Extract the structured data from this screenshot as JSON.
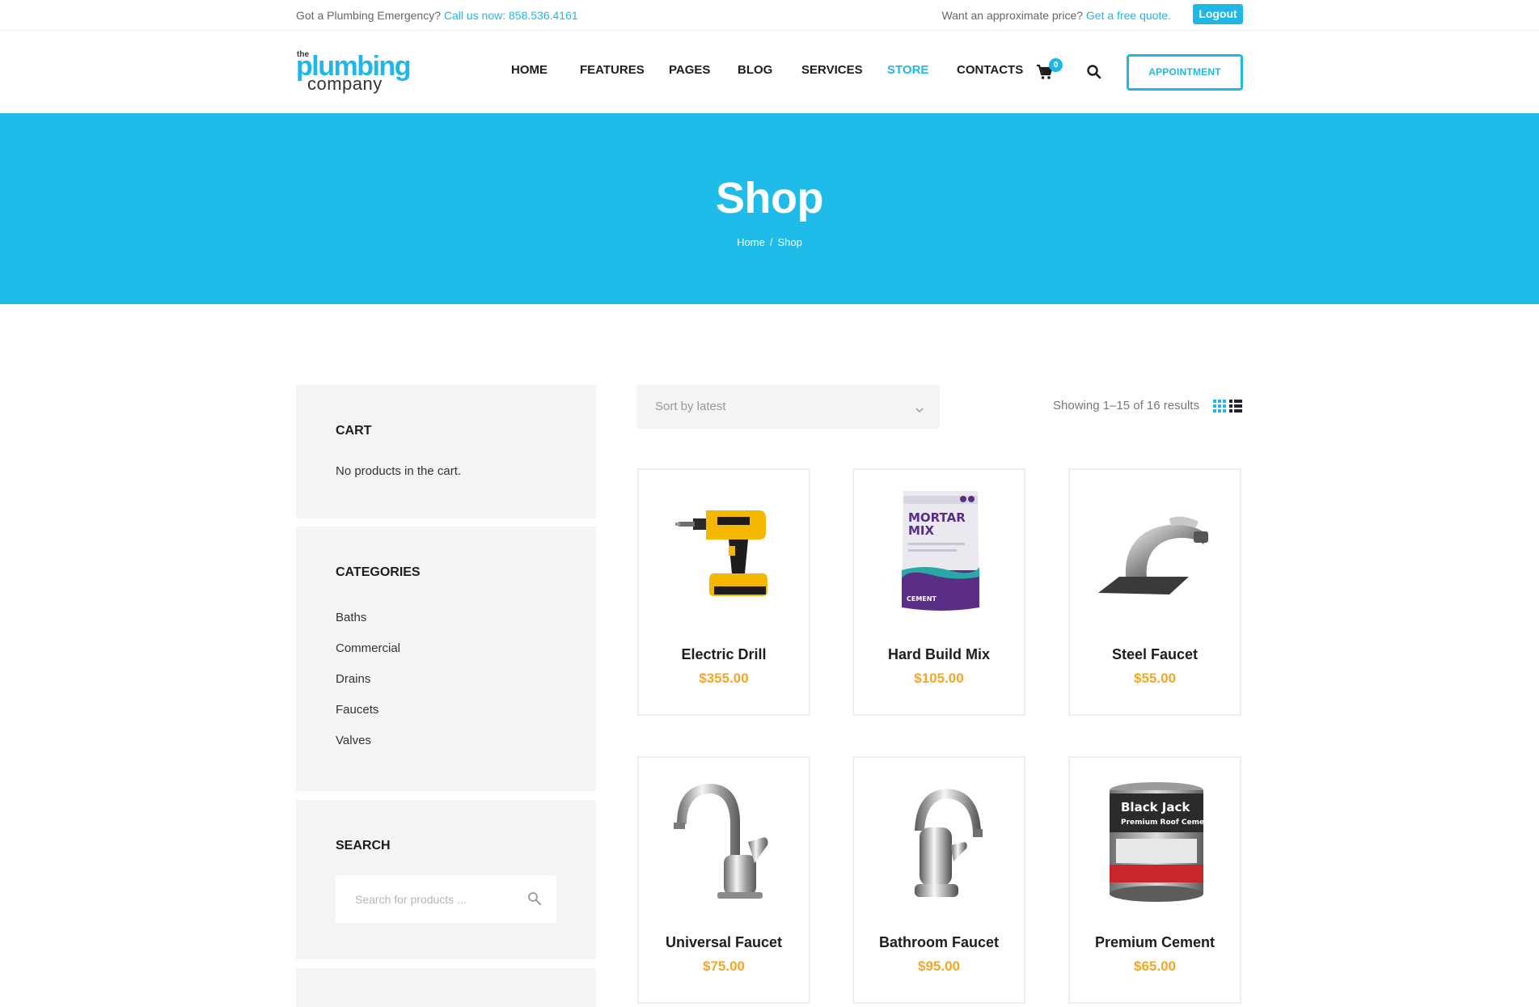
{
  "topbar": {
    "emergency_text": "Got a Plumbing Emergency?",
    "phone_text": "Call us now: 858.536.4161",
    "price_text": "Want an approximate price?",
    "quote_link": "Get a free quote.",
    "logout_label": "Logout"
  },
  "logo": {
    "the": "the",
    "plumbing": "plumbing",
    "company": "company"
  },
  "nav": {
    "items": [
      "HOME",
      "FEATURES",
      "PAGES",
      "BLOG",
      "SERVICES",
      "STORE",
      "CONTACTS"
    ],
    "active": "STORE",
    "cart_count": "0",
    "appointment_label": "APPOINTMENT"
  },
  "banner": {
    "title": "Shop",
    "breadcrumb": {
      "home": "Home",
      "separator": "/",
      "current": "Shop"
    }
  },
  "sidebar": {
    "cart": {
      "title": "CART",
      "empty_text": "No products in the cart."
    },
    "categories": {
      "title": "CATEGORIES",
      "items": [
        "Baths",
        "Commercial",
        "Drains",
        "Faucets",
        "Valves"
      ]
    },
    "search": {
      "title": "SEARCH",
      "placeholder": "Search for products ..."
    }
  },
  "toolbar": {
    "sort_value": "Sort by latest",
    "result_count": "Showing 1–15 of 16 results"
  },
  "products": [
    {
      "name": "Electric Drill",
      "price": "$355.00",
      "icon": "drill-icon"
    },
    {
      "name": "Hard Build Mix",
      "price": "$105.00",
      "icon": "mortar-bag-icon",
      "bag_text_1": "MORTAR",
      "bag_text_2": "MIX",
      "bag_text_3": "CEMENT"
    },
    {
      "name": "Steel Faucet",
      "price": "$55.00",
      "icon": "faucet-icon"
    },
    {
      "name": "Universal Faucet",
      "price": "$75.00",
      "icon": "faucet-icon"
    },
    {
      "name": "Bathroom Faucet",
      "price": "$95.00",
      "icon": "faucet-icon"
    },
    {
      "name": "Premium Cement",
      "price": "$65.00",
      "icon": "paint-can-icon",
      "can_text_1": "Black Jack",
      "can_text_2": "Premium Roof Cement"
    }
  ],
  "colors": {
    "accent": "#1fb8e6",
    "price": "#f5a623",
    "widget_bg": "#f4f4f4"
  }
}
